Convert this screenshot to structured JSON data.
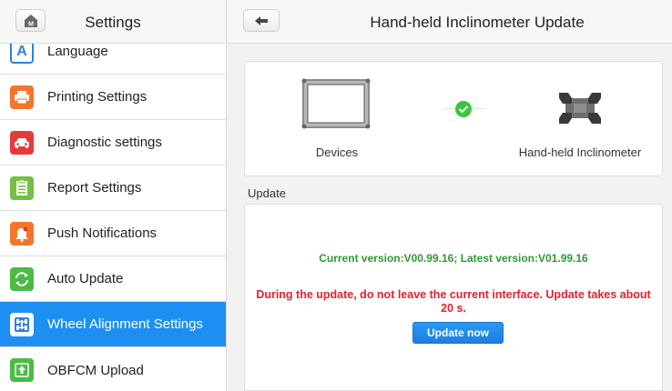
{
  "sidebar": {
    "title": "Settings",
    "home_glyph": "M",
    "items": [
      {
        "label": "Language",
        "icon": "language-icon",
        "color": "#2f7fe4"
      },
      {
        "label": "Printing Settings",
        "icon": "printer-icon",
        "color": "#f4762a"
      },
      {
        "label": "Diagnostic settings",
        "icon": "car-icon",
        "color": "#e43a3a"
      },
      {
        "label": "Report Settings",
        "icon": "report-icon",
        "color": "#74c044"
      },
      {
        "label": "Push Notifications",
        "icon": "bell-icon",
        "color": "#f4762a"
      },
      {
        "label": "Auto Update",
        "icon": "sync-icon",
        "color": "#4cbb45"
      },
      {
        "label": "Wheel Alignment Settings",
        "icon": "wheel-alignment-icon",
        "color": "#2f7fe4",
        "active": true
      },
      {
        "label": "OBFCM Upload",
        "icon": "upload-icon",
        "color": "#4cbb45"
      }
    ]
  },
  "main": {
    "title": "Hand-held Inclinometer Update",
    "devices": {
      "left_label": "Devices",
      "right_label": "Hand-held Inclinometer",
      "status": "connected"
    },
    "section_label": "Update",
    "version_text": "Current version:V00.99.16; Latest version:V01.99.16",
    "warning_text": "During the update, do not leave the current interface. Update takes about 20 s.",
    "update_button": "Update now"
  },
  "colors": {
    "accent": "#1e8ff2",
    "success": "#2e9b2e",
    "warning": "#e8202a"
  }
}
